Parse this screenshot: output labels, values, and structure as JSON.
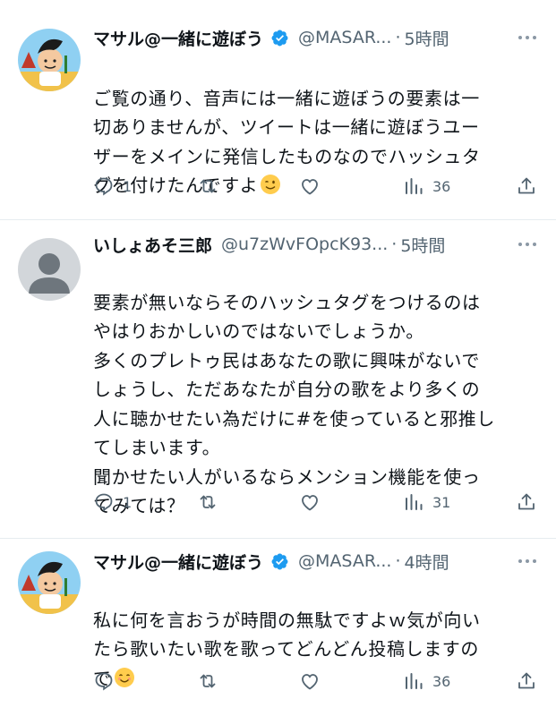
{
  "tweets": [
    {
      "name": "マサル@一緒に遊ぼう",
      "handle": "@MASAR...",
      "dot": "·",
      "time": "5時間",
      "verified": true,
      "text": "ご覧の通り、音声には一緒に遊ぼうの要素は一\n切ありませんが、ツイートは一緒に遊ぼうユー\nザーをメインに発信したものなのでハッシュタ\nグを付けたんですよ",
      "emoji": "wink-emoji",
      "replies": "1",
      "retweets": "",
      "likes": "",
      "views": "36"
    },
    {
      "name": "いしょあそ三郎",
      "handle": "@u7zWvFOpcK93...",
      "dot": "·",
      "time": "5時間",
      "verified": false,
      "text": "要素が無いならそのハッシュタグをつけるのは\nやはりおかしいのではないでしょうか。\n多くのプレトゥ民はあなたの歌に興味がないで\nしょうし、ただあなたが自分の歌をより多くの\n人に聴かせたい為だけに#を使っていると邪推し\nてしまいます。\n聞かせたい人がいるならメンション機能を使っ\nてみては？",
      "emoji": "",
      "replies": "1",
      "retweets": "",
      "likes": "",
      "views": "31"
    },
    {
      "name": "マサル@一緒に遊ぼう",
      "handle": "@MASAR...",
      "dot": "·",
      "time": "4時間",
      "verified": true,
      "text": "私に何を言おうが時間の無駄ですよｗ気が向い\nたら歌いたい歌を歌ってどんどん投稿しますの\nで",
      "emoji": "smile-emoji",
      "replies": "",
      "retweets": "",
      "likes": "",
      "views": "36"
    }
  ],
  "colors": {
    "text": "#0f1419",
    "secondary": "#536471",
    "verified": "#1d9bf0",
    "separator": "#e6ecf0"
  }
}
